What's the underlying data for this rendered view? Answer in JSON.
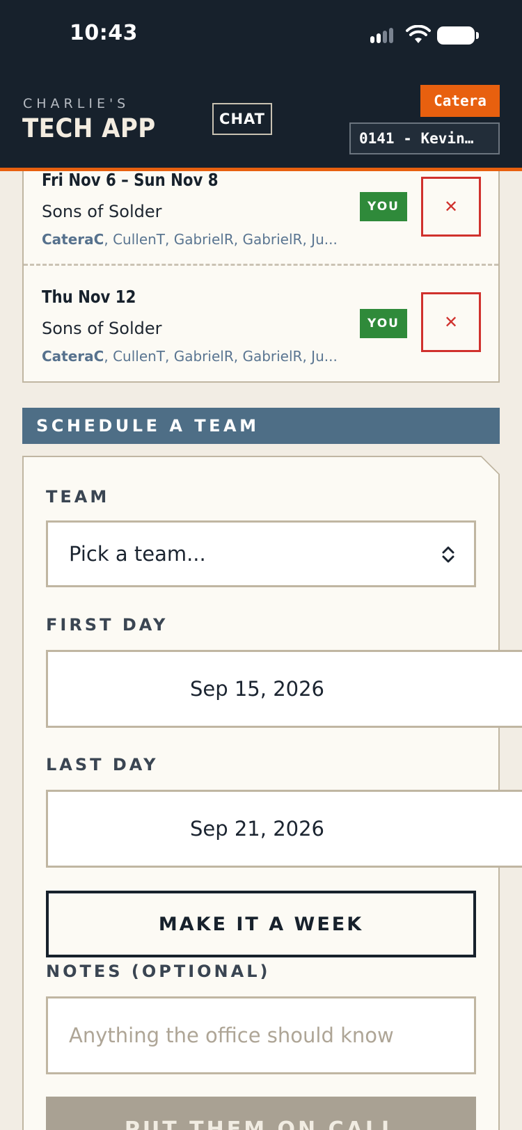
{
  "status_bar": {
    "time": "10:43"
  },
  "header": {
    "brand_top": "CHARLIE'S",
    "brand_main": "TECH APP",
    "chat_label": "CHAT",
    "user_badge": "Catera",
    "store_selector": "0141 - Kevin…"
  },
  "bookings": [
    {
      "date": "Fri Nov 6 – Sun Nov 8",
      "team": "Sons of Solder",
      "crew": [
        "CateraC",
        "CullenT",
        "GabrielR",
        "GabrielR",
        "Ju..."
      ],
      "you_label": "YOU",
      "remove_glyph": "✕"
    },
    {
      "date": "Thu Nov 12",
      "team": "Sons of Solder",
      "crew": [
        "CateraC",
        "CullenT",
        "GabrielR",
        "GabrielR",
        "Ju..."
      ],
      "you_label": "YOU",
      "remove_glyph": "✕"
    }
  ],
  "schedule": {
    "header": "SCHEDULE A TEAM",
    "team_label": "TEAM",
    "team_value": "Pick a team...",
    "first_day_label": "FIRST DAY",
    "first_day_value": "Sep 15, 2026",
    "last_day_label": "LAST DAY",
    "last_day_value": "Sep 21, 2026",
    "week_button": "MAKE IT A WEEK",
    "notes_label": "NOTES (OPTIONAL)",
    "notes_placeholder": "Anything the office should know",
    "submit_button": "PUT THEM ON CALL"
  },
  "colors": {
    "header_bg": "#17212c",
    "accent": "#e8600f",
    "section_header": "#4e6e86",
    "you_badge": "#2f8a3a",
    "remove": "#d0312d",
    "card_bg": "#fcfaf4",
    "page_bg": "#f2ede4"
  },
  "icons": {
    "signal": "cellular-signal-icon",
    "wifi": "wifi-icon",
    "battery": "battery-icon",
    "remove": "close-icon",
    "select": "chevron-up-down-icon"
  }
}
